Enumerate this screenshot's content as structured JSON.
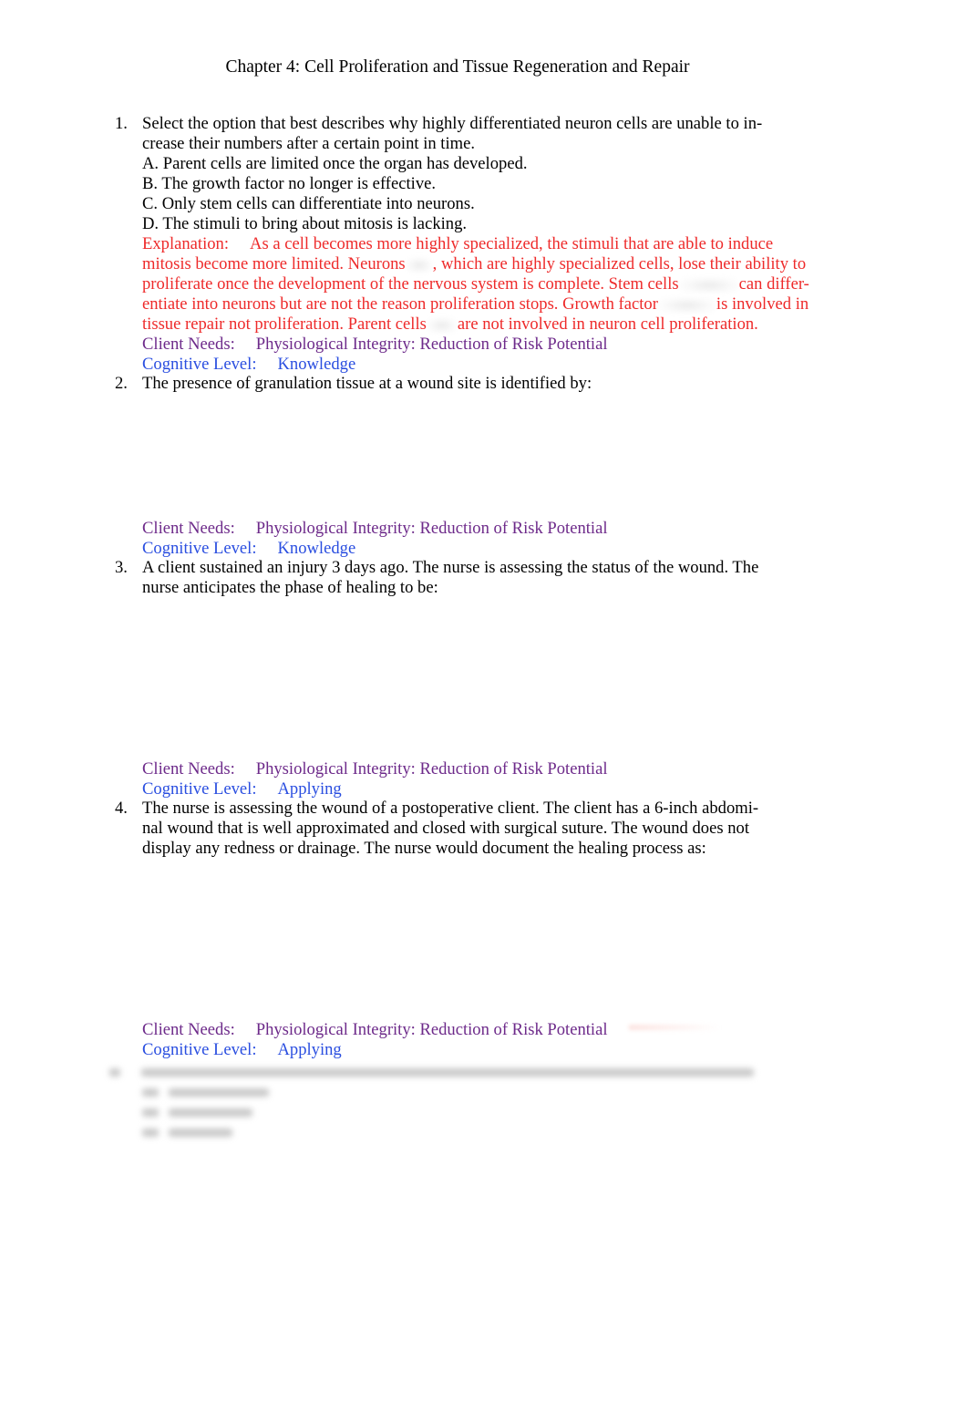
{
  "document": {
    "title": "Chapter 4: Cell Proliferation and Tissue Regeneration and Repair"
  },
  "questions": [
    {
      "number": "1.",
      "stem_lines": [
        "Select the option that best describes why highly differentiated neuron cells are unable to in-",
        "crease their numbers after a certain point in time."
      ],
      "options": [
        "A. Parent cells are limited once the organ has developed.",
        "B. The growth factor no longer is effective.",
        "C. Only stem cells can differentiate into neurons.",
        "D. The stimuli to bring about mitosis is lacking."
      ],
      "explanation": {
        "label": "Explanation:",
        "line1": "As a cell becomes more highly specialized, the stimuli that are able to induce",
        "line2a": "mitosis become more limited. Neurons",
        "line2b": ", which are highly specialized cells, lose their ability to",
        "line3a": "proliferate once the development of the nervous system is complete. Stem cells",
        "line3b": "can differ-",
        "line4a": "entiate into neurons but are not the reason proliferation stops. Growth factor",
        "line4b": "is involved in",
        "line5a": "tissue repair not proliferation. Parent cells",
        "line5b": "are not involved in neuron cell proliferation."
      },
      "client_needs_label": "Client Needs:",
      "client_needs_value": "Physiological Integrity: Reduction of Risk Potential",
      "cognitive_level_label": "Cognitive Level:",
      "cognitive_level_value": "Knowledge"
    },
    {
      "number": "2.",
      "stem_lines": [
        "The presence of granulation tissue at a wound site is identified by:"
      ],
      "client_needs_label": "Client Needs:",
      "client_needs_value": "Physiological Integrity: Reduction of Risk Potential",
      "cognitive_level_label": "Cognitive Level:",
      "cognitive_level_value": "Knowledge"
    },
    {
      "number": "3.",
      "stem_lines": [
        "A client sustained an injury 3 days ago. The nurse is assessing the status of the wound. The",
        "nurse anticipates the phase of healing to be:"
      ],
      "client_needs_label": "Client Needs:",
      "client_needs_value": "Physiological Integrity: Reduction of Risk Potential",
      "cognitive_level_label": "Cognitive Level:",
      "cognitive_level_value": "Applying"
    },
    {
      "number": "4.",
      "stem_lines": [
        "The nurse is assessing the wound of a postoperative client. The client has a 6-inch abdomi-",
        "nal wound that is well approximated and closed with surgical suture. The wound does not",
        "display any redness or drainage. The nurse would document the healing process as:"
      ],
      "client_needs_label": "Client Needs:",
      "client_needs_value": "Physiological Integrity: Reduction of Risk Potential",
      "cognitive_level_label": "Cognitive Level:",
      "cognitive_level_value": "Applying"
    }
  ],
  "colors": {
    "text": "#000000",
    "explanation": "#ee2a2a",
    "client_needs": "#6d2a8a",
    "cognitive_level": "#2a4ee0"
  }
}
